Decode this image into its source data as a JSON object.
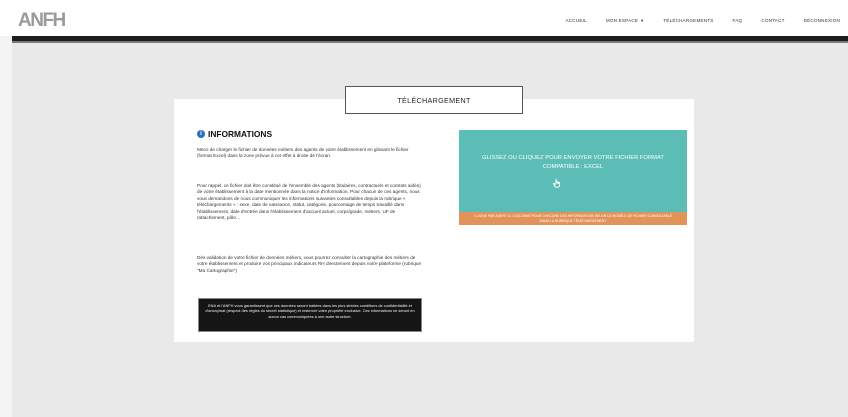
{
  "header": {
    "logo_text": "ANFH",
    "nav": [
      {
        "label": "ACCUEIL"
      },
      {
        "label": "MON ESPACE",
        "has_caret": true
      },
      {
        "label": "TÉLÉCHARGEMENTS"
      },
      {
        "label": "FAQ"
      },
      {
        "label": "CONTACT"
      },
      {
        "label": "DÉCONNEXION"
      }
    ]
  },
  "page": {
    "title": "TÉLÉCHARGEMENT",
    "info_title": "INFORMATIONS",
    "paragraphs": [
      "Merci de charger le fichier de données métiers des agents de votre établissement en glissant le fichier (format Excel) dans la zone prévue à cet effet à droite de l'écran.",
      "Pour rappel, ce fichier doit être constitué de l'ensemble des agents (titulaires, contractuels et contrats aidés) de votre établissement à la date mentionnée dans la notice d'information. Pour chacun de ces agents, nous vous demandons de nous communiquer les informations suivantes consultables depuis la rubrique « téléchargements » : sexe, date de naissance, statut, catégorie, pourcentage de temps travaillé dans l'établissement, date d'entrée dans l'établissement d'accueil actuel, corps/grade, métiers, UF de rattachement, pôle…",
      "Dès validation de votre fichier de données métiers, vous pourrez consulter la cartographie des métiers de votre établissement et produire vos principaux indicateurs RH directement depuis notre plateforme (rubrique \"Ma Cartographie\")"
    ],
    "notice": "ENA et l'ANFH vous garantissent que ces données seront traitées dans les plus strictes conditions de confidentialité et d'anonymat (respect des règles du secret statistique) et resteront votre propriété exclusive. Ces informations ne seront en aucun cas communiquées à une autre structure.",
    "dropzone": {
      "text": "GLISSEZ OU CLIQUEZ POUR ENVOYER VOTRE FICHIER FORMAT COMPATIBLE : EXCEL",
      "footer": "1 ligne par agent & 1 colonne pour chacune des informations selon le modèle de fichier consultable dans la rubrique téléchargement"
    }
  },
  "colors": {
    "dropzone": "#5cbdb6",
    "dropzone_footer": "#e2935a",
    "info_icon": "#2a73b9",
    "header_rule": "#1d1d1d"
  }
}
